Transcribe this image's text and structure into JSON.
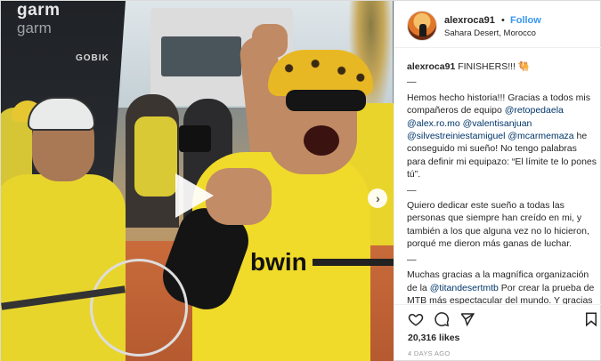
{
  "media": {
    "banner_line1": "garm",
    "banner_line2": "garm",
    "sponsor": "GOBIK",
    "jersey_brand": "bwin"
  },
  "header": {
    "username": "alexroca91",
    "separator": "•",
    "follow_label": "Follow",
    "location": "Sahara Desert, Morocco"
  },
  "caption": {
    "username": "alexroca91",
    "title": "FINISHERS!!! 🐫",
    "dash1": "—",
    "p1_a": "Hemos hecho historia!!! Gracias a todos mis compañeros de equipo ",
    "m1": "@retopedaela",
    "m2": "@alex.ro.mo",
    "m3": "@valentisanjuan",
    "m4": "@silvestreiniestamiguel",
    "p1_b": " ",
    "m5": "@mcarmemaza",
    "p1_c": " he conseguido mi sueño! No tengo palabras para definir mi equipazo: “El límite te lo pones tú”.",
    "dash2": "—",
    "p2": "Quiero dedicar este sueño a todas las personas que siempre han creído en mi, y también a los que alguna vez no lo hicieron, porqué me dieron más ganas de luchar.",
    "dash3": "—",
    "p3_a": "Muchas gracias a la magnífica organización de la ",
    "m6": "@titandesertmtb",
    "p3_b": " Por crear la prueba de MTB más espectacular del mundo. Y gracias a mis patrocinadores por ayudarme"
  },
  "actions": {
    "like_icon": "heart-icon",
    "comment_icon": "comment-icon",
    "share_icon": "share-icon",
    "save_icon": "bookmark-icon"
  },
  "likes": "20,316 likes",
  "time": "4 DAYS AGO",
  "colors": {
    "link": "#3897f0",
    "mention": "#003569",
    "text": "#262626",
    "muted": "#999999"
  }
}
